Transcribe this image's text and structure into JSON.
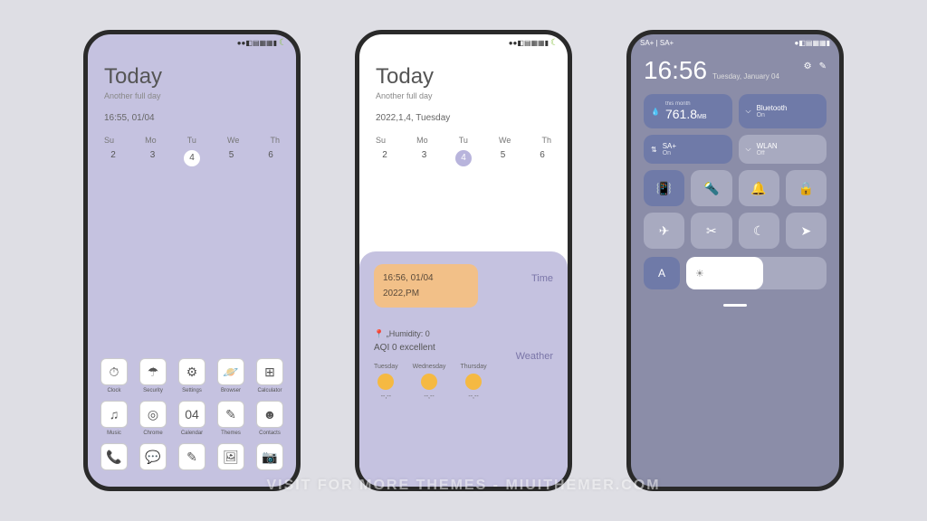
{
  "phone1": {
    "title": "Today",
    "subtitle": "Another full day",
    "time_date": "16:55,  01/04",
    "weekdays": [
      "Su",
      "Mo",
      "Tu",
      "We",
      "Th"
    ],
    "dates": [
      "2",
      "3",
      "4",
      "5",
      "6"
    ],
    "active_date_index": 2,
    "apps_row1": [
      {
        "label": "Clock",
        "glyph": "⏱"
      },
      {
        "label": "Security",
        "glyph": "☂"
      },
      {
        "label": "Settings",
        "glyph": "⚙"
      },
      {
        "label": "Browser",
        "glyph": "🪐"
      },
      {
        "label": "Calculator",
        "glyph": "⊞"
      }
    ],
    "apps_row2": [
      {
        "label": "Music",
        "glyph": "♫"
      },
      {
        "label": "Chrome",
        "glyph": "◎"
      },
      {
        "label": "Calendar",
        "glyph": "04"
      },
      {
        "label": "Themes",
        "glyph": "✎"
      },
      {
        "label": "Contacts",
        "glyph": "☻"
      }
    ],
    "dock": [
      "📞",
      "💬",
      "✎",
      "🖼",
      "📷"
    ]
  },
  "phone2": {
    "title": "Today",
    "subtitle": "Another full day",
    "date_full": "2022,1,4,  Tuesday",
    "weekdays": [
      "Su",
      "Mo",
      "Tu",
      "We",
      "Th"
    ],
    "dates": [
      "2",
      "3",
      "4",
      "5",
      "6"
    ],
    "time_card_line1": "16:56,  01/04",
    "time_card_line2": "2022,PM",
    "side_time": "Time",
    "side_weather": "Weather",
    "humidity": "📍  „Humidity:  0",
    "aqi": "AQI  0  excellent",
    "forecast": [
      {
        "day": "Tuesday",
        "temp": "--,--"
      },
      {
        "day": "Wednesday",
        "temp": "--,--"
      },
      {
        "day": "Thursday",
        "temp": "--,--"
      }
    ]
  },
  "phone3": {
    "carrier": "SA+ | SA+",
    "time": "16:56",
    "date": "Tuesday, January 04",
    "data_label": "this month",
    "data_value": "761.8",
    "data_unit": "MB",
    "bluetooth": {
      "label": "Bluetooth",
      "status": "On"
    },
    "mobile": {
      "label": "SA+",
      "status": "On"
    },
    "wlan": {
      "label": "WLAN",
      "status": "Off"
    },
    "auto": "A"
  },
  "watermark": "VISIT FOR MORE THEMES - MIUITHEMER.COM"
}
